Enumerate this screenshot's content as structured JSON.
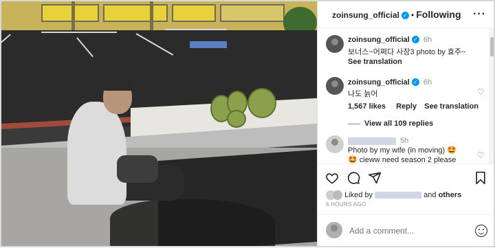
{
  "header": {
    "username": "zoinsung_official",
    "follow_status": "Following",
    "more_icon": "more-horizontal-icon"
  },
  "caption": {
    "username": "zoinsung_official",
    "time": "6h",
    "text": "보너스~어쩌다 사장3 photo by 효주~",
    "see_translation": "See translation"
  },
  "comment1": {
    "username": "zoinsung_official",
    "time": "6h",
    "text": "나도 늙어",
    "likes": "1,567 likes",
    "reply": "Reply",
    "see_translation": "See translation",
    "view_replies": "View all 109 replies"
  },
  "comment2": {
    "time": "5h",
    "text_line1": "Photo by my wife (in moving) 🤩",
    "text_line2": "🤩 cieww need season 2 please"
  },
  "liked_by": {
    "prefix": "Liked by",
    "suffix": "and",
    "others": "others"
  },
  "post_age": "6 HOURS AGO",
  "add_comment": {
    "placeholder": "Add a comment..."
  },
  "colors": {
    "verified": "#0095f6",
    "text": "#262626",
    "muted": "#8e8e8e"
  }
}
